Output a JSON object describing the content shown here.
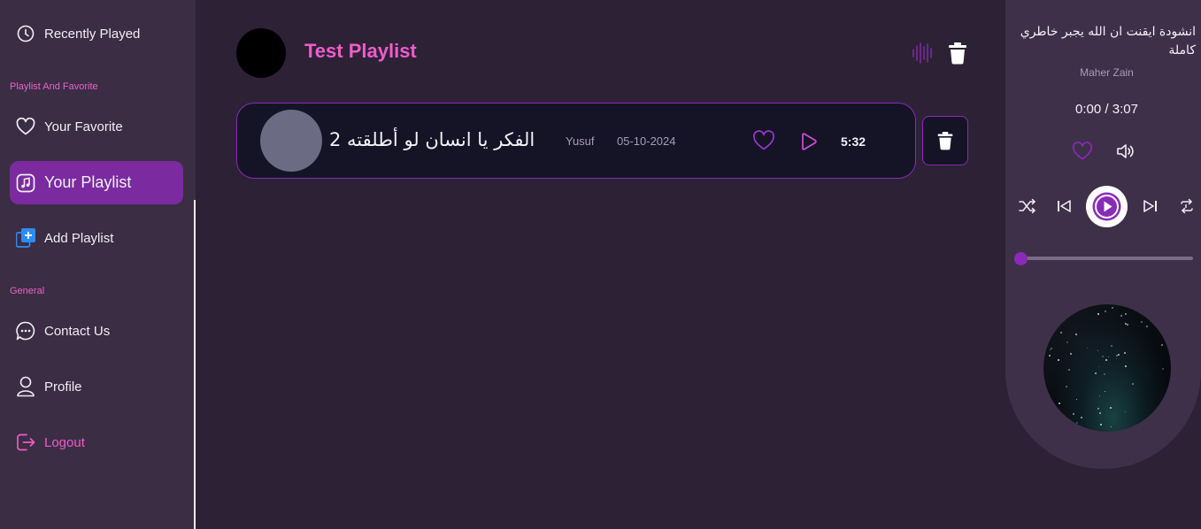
{
  "sidebar": {
    "recently_played": "Recently Played",
    "section_playlist": "Playlist And Favorite",
    "your_favorite": "Your Favorite",
    "your_playlist": "Your Playlist",
    "add_playlist": "Add Playlist",
    "section_general": "General",
    "contact_us": "Contact Us",
    "profile": "Profile",
    "logout": "Logout"
  },
  "playlist": {
    "title": "Test Playlist"
  },
  "songs": [
    {
      "title": "الفكر يا انسان لو أطلقته 2",
      "artist": "Yusuf",
      "date": "05-10-2024",
      "duration": "5:32"
    }
  ],
  "player": {
    "title_line1": "انشودة ايقنت ان الله يجبر خاطري",
    "title_line2": "كاملة",
    "artist": "Maher Zain",
    "time": "0:00 / 3:07",
    "progress": 0
  },
  "colors": {
    "accent": "#7b2aa0",
    "pink": "#ef5ccc",
    "background": "#2d2135",
    "sidebar": "#3b2d44"
  },
  "icons": {
    "recently_played": "clock-icon",
    "favorite": "heart-icon",
    "playlist": "music-note-square-icon",
    "add_playlist": "add-playlist-icon",
    "contact": "chat-bubble-icon",
    "profile": "user-icon",
    "logout": "logout-icon"
  }
}
